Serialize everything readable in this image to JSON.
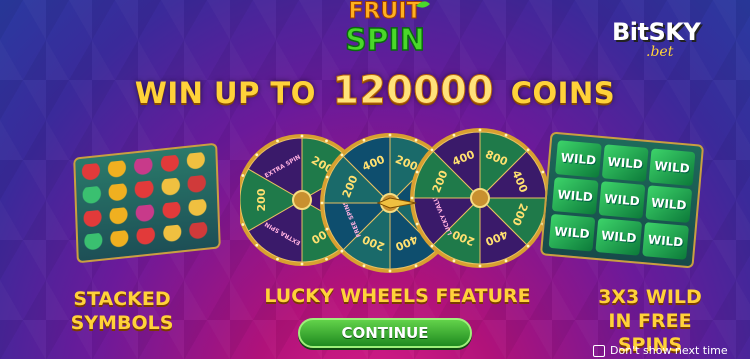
{
  "logo": {
    "line1": "FRUIT",
    "line2": "SPIN"
  },
  "brand": {
    "name": "BitSKY",
    "suffix": ".bet"
  },
  "headline": {
    "prefix": "WIN UP TO",
    "amount": "120000",
    "suffix": "COINS"
  },
  "features": {
    "left_label": "STACKED SYMBOLS",
    "left_line1": "STACKED",
    "left_line2": "SYMBOLS",
    "middle_label": "LUCKY WHEELS FEATURE",
    "right_line1": "3X3 WILD",
    "right_line2": "IN FREE SPINS"
  },
  "wild_text": "WILD",
  "wheels": [
    {
      "segments": [
        "200",
        "EXTRA SPIN",
        "200",
        "EXTRA SPIN",
        "200",
        "EXTRA SPIN"
      ]
    },
    {
      "segments": [
        "200",
        "400",
        "800",
        "400",
        "200",
        "FREE SPINS",
        "200",
        "400"
      ]
    },
    {
      "segments": [
        "800",
        "400",
        "200",
        "400",
        "200",
        "LUCKY VALUE",
        "200",
        "400"
      ]
    }
  ],
  "continue_button": "CONTINUE",
  "dont_show": "Don't show next time",
  "colors": {
    "accent_gold": "#ffd23a",
    "button_green": "#3aaa30",
    "wild_green": "#2cc060"
  }
}
